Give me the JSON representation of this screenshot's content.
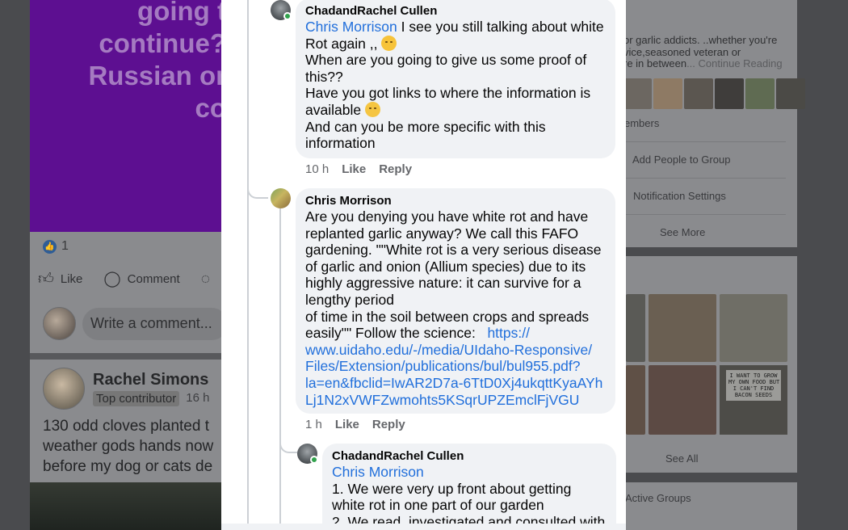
{
  "left_feed": {
    "post_text_lines": [
      "going t",
      "continue?",
      "Russian or",
      "co"
    ],
    "like_count": "1",
    "actions": {
      "like": "Like",
      "comment": "Comment"
    },
    "write_placeholder": "Write a comment...",
    "post2": {
      "author": "Rachel Simons",
      "badge": "Top contributor",
      "time": "16 h",
      "body": "130 odd cloves planted t\nweather gods hands now\nbefore my dog or cats de"
    }
  },
  "right_sidebar": {
    "about_lines": [
      "or garlic addicts. ..whether you're",
      "vice,seasoned veteran or",
      "re in between"
    ],
    "continue_reading": "... Continue Reading",
    "members": "embers",
    "add_people": "Add People to Group",
    "notification_settings": "Notification Settings",
    "see_more": "See More",
    "see_all": "See All",
    "active_groups": "Active Groups",
    "sign_text": "I WANT TO GROW\nMY OWN FOOD BUT\nI CAN'T FIND\nBACON SEEDS"
  },
  "comments": [
    {
      "author": "ChadandRachel Cullen",
      "mention": "Chris Morrison",
      "text_first": " I see you still talking about white",
      "text_line2": "Rot again ,, ",
      "text_rest": "When are you going to give us some proof of\nthis??\nHave you got links to where the information is\navailable ",
      "text_end": "And can you be more specific with this\ninformation",
      "time": "10 h",
      "like": "Like",
      "reply": "Reply"
    },
    {
      "author": "Chris Morrison",
      "text": "Are you denying you have white rot and have\nreplanted garlic anyway? We call this FAFO\ngardening. \"\"White rot is a very serious disease\nof garlic and onion (Allium species) due to its\nhighly aggressive nature: it can survive for a\nlengthy period\nof time in the soil between crops and spreads\neasily\"\" Follow the science:   ",
      "link_first": "https://",
      "link_rest": "www.uidaho.edu/-/media/UIdaho-Responsive/\nFiles/Extension/publications/bul/bul955.pdf?\nla=en&fbclid=IwAR2D7a-6TtD0Xj4ukqttKyaAYh\nLj1N2xVWFZwmohts5KSqrUPZEmclFjVGU",
      "time": "1 h",
      "like": "Like",
      "reply": "Reply"
    },
    {
      "author": "ChadandRachel Cullen",
      "mention": "Chris Morrison",
      "text": "1. We were very up front about getting\nwhite rot in one part of our garden\n2. We read, investigated and consulted with"
    }
  ],
  "colors": {
    "mention": "#216fdb",
    "bubble": "#f0f2f5",
    "online": "#31a24c",
    "purple_post": "#5d0f91"
  }
}
